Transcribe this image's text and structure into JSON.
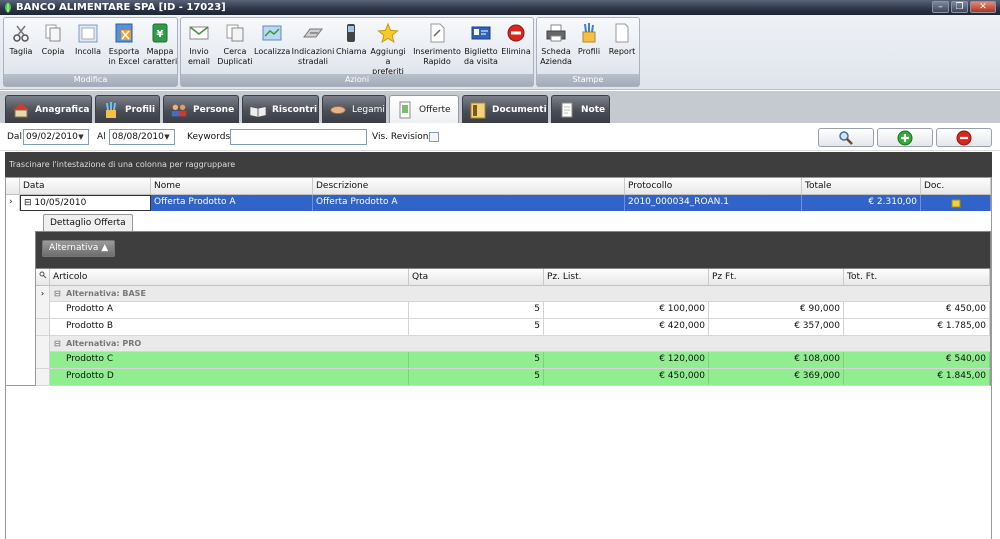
{
  "window": {
    "title": "BANCO ALIMENTARE SPA [ID - 17023]"
  },
  "ribbon": {
    "groups": [
      {
        "label": "Modifica"
      },
      {
        "label": "Azioni"
      },
      {
        "label": "Stampe"
      }
    ],
    "buttons": {
      "taglia": [
        "Taglia"
      ],
      "copia": [
        "Copia"
      ],
      "incolla": [
        "Incolla"
      ],
      "esporta": [
        "Esporta",
        "in Excel"
      ],
      "mappa": [
        "Mappa",
        "caratteri"
      ],
      "invio": [
        "Invio",
        "email"
      ],
      "cerca": [
        "Cerca",
        "Duplicati"
      ],
      "localizza": [
        "Localizza"
      ],
      "indicazioni": [
        "Indicazioni",
        "stradali"
      ],
      "chiama": [
        "Chiama"
      ],
      "aggiungi": [
        "Aggiungi a",
        "preferiti"
      ],
      "inserimento": [
        "Inserimento",
        "Rapido"
      ],
      "biglietto": [
        "Biglietto",
        "da visita"
      ],
      "elimina": [
        "Elimina"
      ],
      "scheda": [
        "Scheda",
        "Azienda"
      ],
      "profili": [
        "Profili"
      ],
      "report": [
        "Report"
      ]
    }
  },
  "tabs": {
    "anagrafica": "Anagrafica",
    "profili": "Profili",
    "persone": "Persone",
    "riscontri": "Riscontri",
    "legami": "Legami",
    "offerte": "Offerte",
    "documenti": "Documenti",
    "note": "Note"
  },
  "filters": {
    "dal_label": "Dal",
    "dal_value": "09/02/2010",
    "al_label": "Al",
    "al_value": "08/08/2010",
    "keywords_label": "Keywords",
    "keywords_value": "",
    "revisioni_label": "Vis. Revisioni"
  },
  "grid": {
    "group_hint": "Trascinare l'intestazione di una colonna per raggruppare",
    "columns": {
      "data": "Data",
      "nome": "Nome",
      "descrizione": "Descrizione",
      "protocollo": "Protocollo",
      "totale": "Totale",
      "doc": "Doc."
    },
    "row": {
      "data": "10/05/2010",
      "nome": "Offerta Prodotto A",
      "descrizione": "Offerta Prodotto A",
      "protocollo": "2010_000034_ROAN.1",
      "totale": "€ 2.310,00"
    }
  },
  "detail": {
    "tab_label": "Dettaglio Offerta",
    "group_chip": "Alternativa ▲",
    "columns": {
      "articolo": "Articolo",
      "qta": "Qta",
      "pz_list": "Pz. List.",
      "pz_ft": "Pz Ft.",
      "tot_ft": "Tot. Ft."
    },
    "groups": [
      {
        "label": "Alternativa: BASE",
        "rows": [
          {
            "articolo": "Prodotto A",
            "qta": "5",
            "pz_list": "€ 100,000",
            "pz_ft": "€ 90,000",
            "tot_ft": "€ 450,00"
          },
          {
            "articolo": "Prodotto B",
            "qta": "5",
            "pz_list": "€ 420,000",
            "pz_ft": "€ 357,000",
            "tot_ft": "€ 1.785,00"
          }
        ]
      },
      {
        "label": "Alternativa: PRO",
        "rows": [
          {
            "articolo": "Prodotto C",
            "qta": "5",
            "pz_list": "€ 120,000",
            "pz_ft": "€ 108,000",
            "tot_ft": "€ 540,00"
          },
          {
            "articolo": "Prodotto D",
            "qta": "5",
            "pz_list": "€ 450,000",
            "pz_ft": "€ 369,000",
            "tot_ft": "€ 1.845,00"
          }
        ]
      }
    ]
  },
  "colors": {
    "selection": "#3163c8",
    "highlight_row": "#90ee90",
    "band": "#3e3e3e"
  }
}
